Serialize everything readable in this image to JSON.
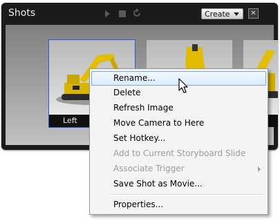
{
  "panel": {
    "title": "Shots",
    "create_label": "Create",
    "close_glyph": "✕",
    "accent_color": "#1f5fd8",
    "background_color": "#1b1b1b"
  },
  "toolbar_icons": [
    "play-icon",
    "stop-icon",
    "refresh-icon"
  ],
  "thumbnails": [
    {
      "label": "Left",
      "selected": true
    },
    {
      "label": "",
      "selected": false
    },
    {
      "label": "ght",
      "selected": false
    }
  ],
  "context_menu": {
    "items": [
      {
        "label": "Rename...",
        "state": "highlighted"
      },
      {
        "label": "Delete",
        "state": "enabled"
      },
      {
        "label": "Refresh Image",
        "state": "enabled"
      },
      {
        "label": "Move Camera to Here",
        "state": "enabled"
      },
      {
        "label": "Set Hotkey...",
        "state": "enabled"
      },
      {
        "label": "Add to Current Storyboard Slide",
        "state": "disabled"
      },
      {
        "label": "Associate Trigger",
        "state": "disabled",
        "has_submenu": true
      },
      {
        "label": "Save Shot as Movie...",
        "state": "enabled"
      },
      {
        "label": "Properties...",
        "state": "enabled"
      }
    ],
    "highlight_color": "#dcebfb"
  }
}
